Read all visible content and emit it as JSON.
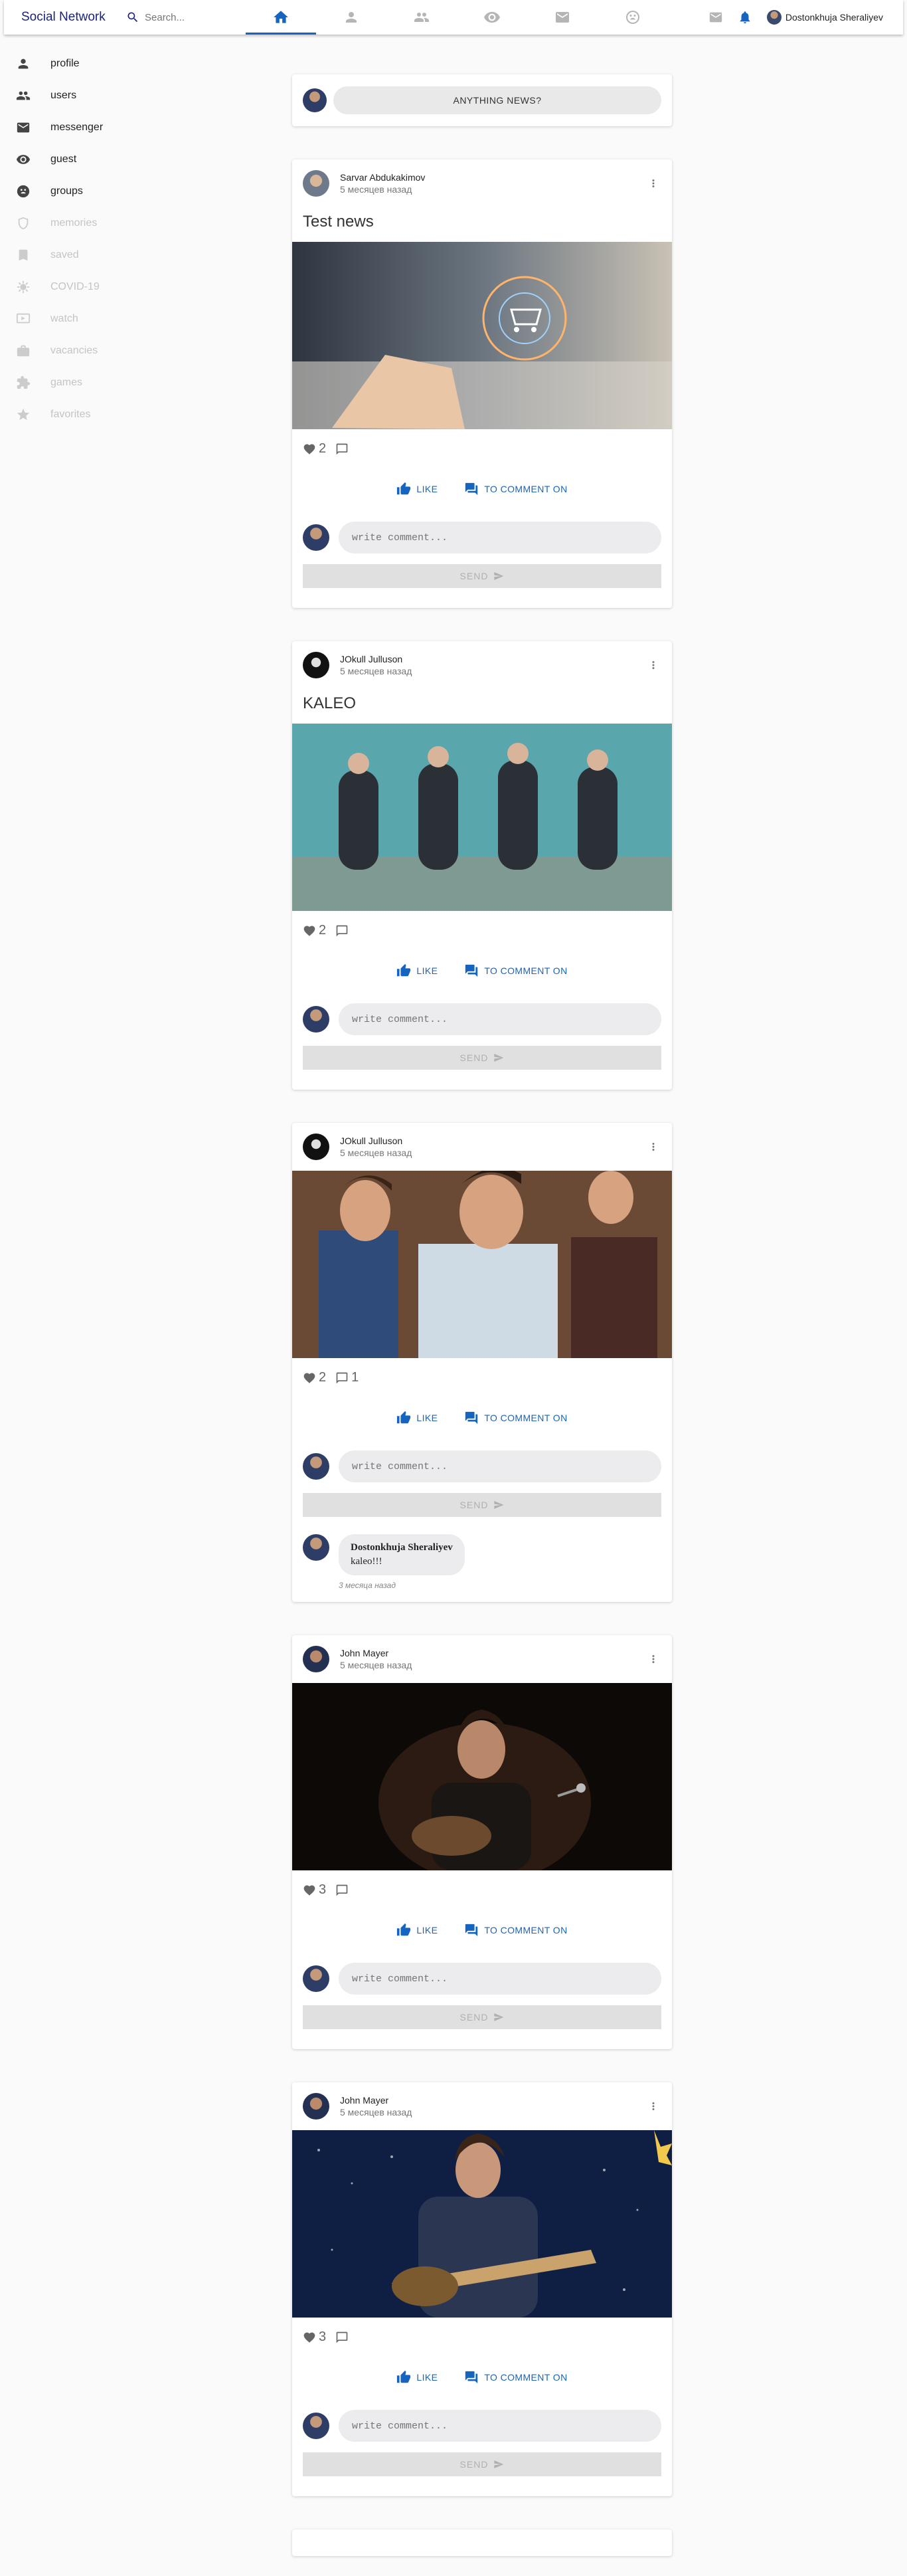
{
  "app": {
    "brand": "Social Network"
  },
  "search": {
    "placeholder": "Search..."
  },
  "topnav": {
    "items": [
      "home",
      "profile",
      "users",
      "guest",
      "messenger",
      "groups"
    ],
    "active": "home"
  },
  "user": {
    "name": "Dostonkhuja Sheraliyev"
  },
  "sidebar": {
    "items": [
      {
        "label": "profile",
        "icon": "person-icon",
        "enabled": true
      },
      {
        "label": "users",
        "icon": "people-icon",
        "enabled": true
      },
      {
        "label": "messenger",
        "icon": "mail-icon",
        "enabled": true
      },
      {
        "label": "guest",
        "icon": "eye-icon",
        "enabled": true
      },
      {
        "label": "groups",
        "icon": "groups-icon",
        "enabled": true
      },
      {
        "label": "memories",
        "icon": "shield-icon",
        "enabled": false
      },
      {
        "label": "saved",
        "icon": "bookmark-icon",
        "enabled": false
      },
      {
        "label": "COVID-19",
        "icon": "virus-icon",
        "enabled": false
      },
      {
        "label": "watch",
        "icon": "video-icon",
        "enabled": false
      },
      {
        "label": "vacancies",
        "icon": "briefcase-icon",
        "enabled": false
      },
      {
        "label": "games",
        "icon": "puzzle-icon",
        "enabled": false
      },
      {
        "label": "favorites",
        "icon": "star-icon",
        "enabled": false
      }
    ]
  },
  "compose": {
    "button_label": "ANYTHING NEWS?"
  },
  "labels": {
    "like": "LIKE",
    "comment": "TO COMMENT ON",
    "comment_placeholder": "write comment...",
    "send": "SEND"
  },
  "posts": [
    {
      "author": "Sarvar Abdukakimov",
      "time": "5 месяцев назад",
      "title": "Test news",
      "likes": "2",
      "comments": ""
    },
    {
      "author": "JOkull Julluson",
      "time": "5 месяцев назад",
      "title": "KALEO",
      "likes": "2",
      "comments": ""
    },
    {
      "author": "JOkull Julluson",
      "time": "5 месяцев назад",
      "title": "",
      "likes": "2",
      "comments": "1",
      "comment_list": [
        {
          "author": "Dostonkhuja Sheraliyev",
          "text": "kaleo!!!",
          "time": "3 месяца назад"
        }
      ]
    },
    {
      "author": "John Mayer",
      "time": "5 месяцев назад",
      "title": "",
      "likes": "3",
      "comments": ""
    },
    {
      "author": "John Mayer",
      "time": "5 месяцев назад",
      "title": "",
      "likes": "3",
      "comments": ""
    }
  ]
}
